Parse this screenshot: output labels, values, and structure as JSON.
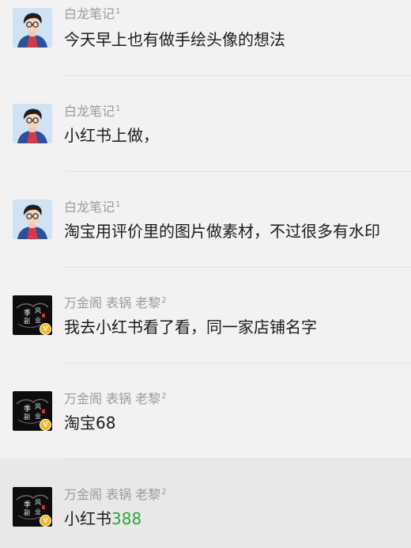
{
  "colors": {
    "background": "#f2f2f2",
    "highlight": "#e8e8e8",
    "sender_text": "#9b9b9b",
    "message_text": "#1b1b1b",
    "number_accent": "#27a83a",
    "badge": "#f6b91c"
  },
  "messages": [
    {
      "sender": "白龙笔记",
      "sender_level": "1",
      "text": "今天早上也有做手绘头像的想法",
      "avatar": "cartoon-boy-avatar"
    },
    {
      "sender": "白龙笔记",
      "sender_level": "1",
      "text": "小红书上做，",
      "avatar": "cartoon-boy-avatar"
    },
    {
      "sender": "白龙笔记",
      "sender_level": "1",
      "text": "淘宝用评价里的图片做素材，不过很多有水印",
      "avatar": "cartoon-boy-avatar"
    },
    {
      "sender": "万金阁 表锅 老黎",
      "sender_level": "2",
      "text": "我去小红书看了看，同一家店铺名字",
      "avatar": "calligraphy-avatar",
      "badge": "V"
    },
    {
      "sender": "万金阁 表锅 老黎",
      "sender_level": "2",
      "text": "淘宝68",
      "avatar": "calligraphy-avatar",
      "badge": "V"
    },
    {
      "sender": "万金阁 表锅 老黎",
      "sender_level": "2",
      "text_prefix": "小红书",
      "text_number": "388",
      "avatar": "calligraphy-avatar",
      "badge": "V",
      "highlighted": true
    }
  ]
}
